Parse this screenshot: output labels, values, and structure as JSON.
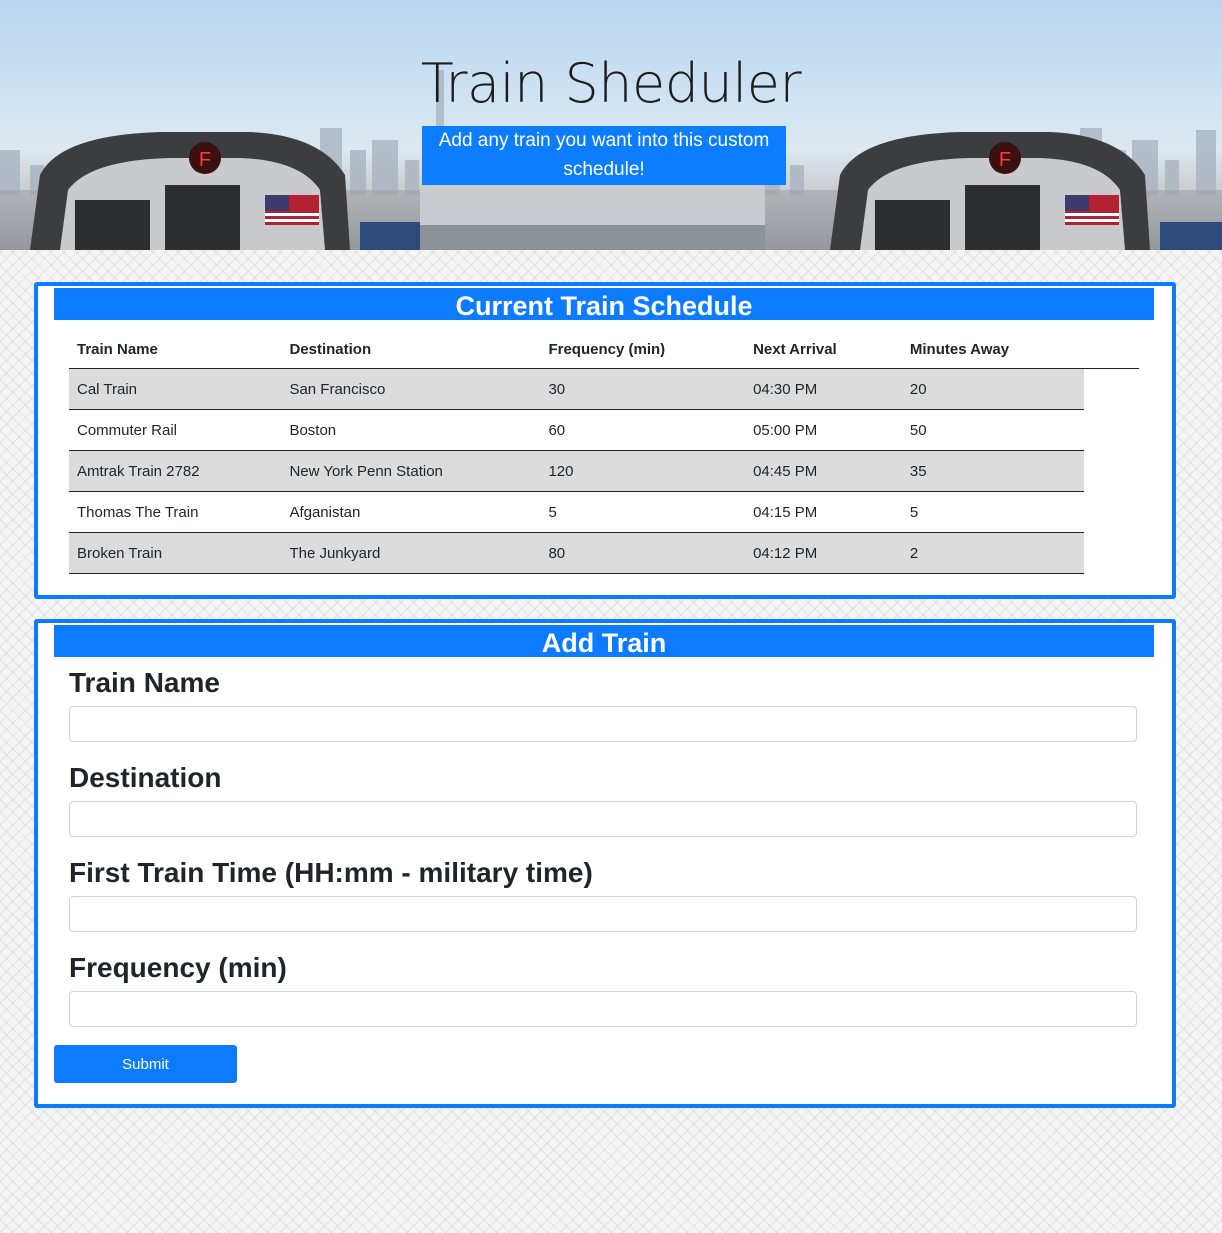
{
  "hero": {
    "title": "Train Sheduler",
    "subtitle": "Add any train you want into this custom schedule!",
    "sign_letter": "F"
  },
  "schedule": {
    "heading": "Current Train Schedule",
    "columns": [
      "Train Name",
      "Destination",
      "Frequency (min)",
      "Next Arrival",
      "Minutes Away"
    ],
    "rows": [
      [
        "Cal Train",
        "San Francisco",
        "30",
        "04:30 PM",
        "20"
      ],
      [
        "Commuter Rail",
        "Boston",
        "60",
        "05:00 PM",
        "50"
      ],
      [
        "Amtrak Train 2782",
        "New York Penn Station",
        "120",
        "04:45 PM",
        "35"
      ],
      [
        "Thomas The Train",
        "Afganistan",
        "5",
        "04:15 PM",
        "5"
      ],
      [
        "Broken Train",
        "The Junkyard",
        "80",
        "04:12 PM",
        "2"
      ]
    ]
  },
  "add_train": {
    "heading": "Add Train",
    "fields": {
      "name": {
        "label": "Train Name",
        "value": ""
      },
      "destination": {
        "label": "Destination",
        "value": ""
      },
      "first_time": {
        "label": "First Train Time (HH:mm - military time)",
        "value": ""
      },
      "frequency": {
        "label": "Frequency (min)",
        "value": ""
      }
    },
    "submit_label": "Submit"
  },
  "colors": {
    "accent": "#0d7bff",
    "row_shade": "#dcdcdc"
  }
}
